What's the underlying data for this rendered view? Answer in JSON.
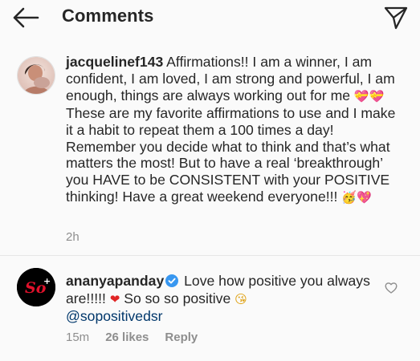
{
  "header": {
    "title": "Comments",
    "back_icon": "arrow-left-icon",
    "send_icon": "paper-plane-icon"
  },
  "caption": {
    "username": "jacquelinef143",
    "text_line_1": " Affirmations!! I am a winner, I am confident, I am loved, I am strong and powerful, I am enough, things are always working out for me ",
    "emoji_1": "💝💝",
    "text_line_2": "These are my favorite affirmations to use and I make it a habit to repeat them a 100 times a day! Remember you decide what to think and that’s what matters the most! But to have a real ‘breakthrough’ you HAVE to be CONSISTENT with your POSITIVE thinking! Have a great weekend everyone!!! ",
    "emoji_2": "🥳",
    "emoji_3": "💖",
    "time": "2h"
  },
  "comment": {
    "username": "ananyapanday",
    "verified": true,
    "text_1": " Love how positive you always are!!!!! ",
    "emoji_heart": "❤",
    "text_2": " So so so positive ",
    "emoji_kiss": "😘",
    "mention": "@sopositivedsr",
    "time": "15m",
    "likes": "26 likes",
    "reply": "Reply",
    "avatar_text": "So",
    "avatar_suffix": "+"
  },
  "colors": {
    "background": "#fafafa",
    "text": "#262626",
    "muted": "#8e8e8e",
    "verified": "#3897f0",
    "mention": "#00376b",
    "avatar_accent": "#e0112b"
  }
}
